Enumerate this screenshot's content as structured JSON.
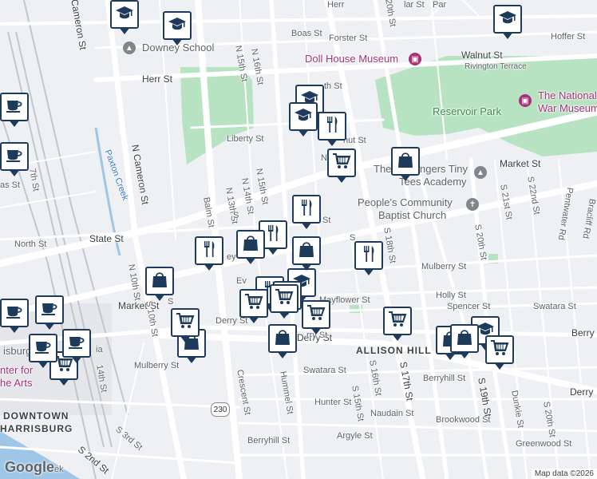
{
  "map": {
    "colors": {
      "background": "#eef0f3",
      "road": "#ffffff",
      "park": "#b8e3c2",
      "water": "#9fc6e6",
      "rail": "#c3c6cc",
      "pin_border": "#1f3b5b"
    },
    "streets": [
      {
        "id": "hoffer-st",
        "text": "Hoffer St"
      },
      {
        "id": "boas-st",
        "text": "Boas St"
      },
      {
        "id": "forster-st",
        "text": "Forster St"
      },
      {
        "id": "walnut-st",
        "text": "Walnut St"
      },
      {
        "id": "rivington-terrace",
        "text": "Rivington Terrace"
      },
      {
        "id": "herr-st",
        "text": "Herr St"
      },
      {
        "id": "liberty-st",
        "text": "Liberty St"
      },
      {
        "id": "market-st-east",
        "text": "Market St"
      },
      {
        "id": "market-st-west",
        "text": "Market St"
      },
      {
        "id": "state-st",
        "text": "State St"
      },
      {
        "id": "north-st",
        "text": "North St"
      },
      {
        "id": "mulberry-st-east",
        "text": "Mulberry St"
      },
      {
        "id": "mulberry-st-west",
        "text": "Mulberry St"
      },
      {
        "id": "holly-st",
        "text": "Holly St"
      },
      {
        "id": "spencer-st",
        "text": "Spencer St"
      },
      {
        "id": "swatara-st-east",
        "text": "Swatara St"
      },
      {
        "id": "swatara-st-south",
        "text": "Swatara St"
      },
      {
        "id": "mayflower-st",
        "text": "Mayflower St"
      },
      {
        "id": "derry-st-west",
        "text": "Derry St"
      },
      {
        "id": "derry-st-mid",
        "text": "Derry St"
      },
      {
        "id": "berry-east",
        "text": "Berry"
      },
      {
        "id": "derry-east",
        "text": "Derry"
      },
      {
        "id": "berryhill-st",
        "text": "Berryhill St"
      },
      {
        "id": "berryhill-st-south",
        "text": "Berryhill St"
      },
      {
        "id": "hunter-st",
        "text": "Hunter St"
      },
      {
        "id": "naudain-st",
        "text": "Naudain St"
      },
      {
        "id": "argyle-st",
        "text": "Argyle St"
      },
      {
        "id": "brookwood-st",
        "text": "Brookwood St"
      },
      {
        "id": "greenwood-st",
        "text": "Greenwood St"
      },
      {
        "id": "n-cameron-st-top",
        "text": "Cameron St"
      },
      {
        "id": "n-cameron-st",
        "text": "N Cameron St"
      },
      {
        "id": "n-16th-st",
        "text": "N 16th St"
      },
      {
        "id": "n-15th-st-top",
        "text": "N 15th St"
      },
      {
        "id": "n-15th-st",
        "text": "N 15th St"
      },
      {
        "id": "n-14th-st",
        "text": "N 14th St"
      },
      {
        "id": "n-13th-st",
        "text": "N 13th St"
      },
      {
        "id": "balm-st",
        "text": "Balm St"
      },
      {
        "id": "n-10th-st",
        "text": "N 10th St"
      },
      {
        "id": "s-10th-st",
        "text": "S 10th St"
      },
      {
        "id": "s-14th-st",
        "text": "14th St"
      },
      {
        "id": "crescent-st",
        "text": "Crescent St"
      },
      {
        "id": "hummel-st",
        "text": "Hummel St"
      },
      {
        "id": "s-16th-st",
        "text": "S 16th St"
      },
      {
        "id": "s-15th-st",
        "text": "S 15th St"
      },
      {
        "id": "s-17th-st",
        "text": "S 17th St"
      },
      {
        "id": "s-18th-st",
        "text": "S 18th St"
      },
      {
        "id": "s-19th-st",
        "text": "S 19th St"
      },
      {
        "id": "s-20th-st",
        "text": "S 20th St"
      },
      {
        "id": "s-20th-st-south",
        "text": "S 20th St"
      },
      {
        "id": "s-21st-st",
        "text": "S 21st St"
      },
      {
        "id": "s-22nd-st",
        "text": "S 22nd St"
      },
      {
        "id": "dunkle-st",
        "text": "Dunkle St"
      },
      {
        "id": "pentwater-rd",
        "text": "Pentwater Rd"
      },
      {
        "id": "bracliff-rd",
        "text": "Bracliff Rd"
      },
      {
        "id": "n-20th-st",
        "text": "20th St"
      },
      {
        "id": "s-3rd-st",
        "text": "S 3rd St"
      },
      {
        "id": "s-2nd-st",
        "text": "S 2nd St"
      },
      {
        "id": "n-7th-st",
        "text": "7th St"
      },
      {
        "id": "paxton-creek",
        "text": "Paxton Creek"
      },
      {
        "id": "frag-herr-top",
        "text": "Herr"
      },
      {
        "id": "frag-th-st",
        "text": "th St"
      },
      {
        "id": "frag-s-1",
        "text": "S"
      },
      {
        "id": "frag-ey",
        "text": "ey"
      },
      {
        "id": "frag-ev",
        "text": "Ev"
      },
      {
        "id": "frag-nut-st",
        "text": "nut St"
      },
      {
        "id": "frag-n",
        "text": "N"
      },
      {
        "id": "frag-s-2",
        "text": "S"
      },
      {
        "id": "frag-ry-st",
        "text": "rry St"
      },
      {
        "id": "frag-lar-st",
        "text": "lar St"
      },
      {
        "id": "frag-par",
        "text": "Par"
      },
      {
        "id": "frag-as-st",
        "text": "as St"
      },
      {
        "id": "frag-st",
        "text": "St"
      },
      {
        "id": "frag-s-3",
        "text": "S"
      },
      {
        "id": "frag-ia",
        "text": "ia"
      },
      {
        "id": "frag-ek",
        "text": "ek"
      }
    ],
    "districts": [
      {
        "id": "allison-hill",
        "text": "ALLISON HILL"
      },
      {
        "id": "downtown",
        "text": "DOWNTOWN"
      },
      {
        "id": "harrisburg",
        "text": "HARRISBURG"
      }
    ],
    "places": [
      {
        "id": "downey-school",
        "text": "Downey School",
        "color": "gray",
        "icon": "school-icon"
      },
      {
        "id": "doll-house-museum",
        "text": "Doll House Museum",
        "color": "purple",
        "icon": "museum-icon"
      },
      {
        "id": "reservoir-park",
        "text": "Reservoir Park",
        "color": "green",
        "icon": "park-icon"
      },
      {
        "id": "national-war-museum-1",
        "text": "The National",
        "color": "purple",
        "icon": "museum-icon"
      },
      {
        "id": "national-war-museum-2",
        "text": "War Museum",
        "color": "purple",
        "icon": ""
      },
      {
        "id": "tiny-tees-1",
        "text": "The",
        "color": "gray",
        "icon": ""
      },
      {
        "id": "tiny-tees-2",
        "text": "ngers Tiny",
        "color": "gray",
        "icon": ""
      },
      {
        "id": "tiny-tees-3",
        "text": "Tees Academy",
        "color": "gray",
        "icon": "school-icon"
      },
      {
        "id": "peoples-church-1",
        "text": "People's Community",
        "color": "gray",
        "icon": "church-icon"
      },
      {
        "id": "peoples-church-2",
        "text": "Baptist Church",
        "color": "gray",
        "icon": ""
      },
      {
        "id": "center-arts-1",
        "text": "nter for",
        "color": "purple",
        "icon": ""
      },
      {
        "id": "center-arts-2",
        "text": "he Arts",
        "color": "purple",
        "icon": ""
      },
      {
        "id": "harrisburg-frag",
        "text": "isburg",
        "color": "gray",
        "icon": ""
      }
    ],
    "route_shields": [
      {
        "id": "us-230",
        "text": "230"
      }
    ],
    "markers": [
      {
        "type": "school",
        "name": "school-marker"
      },
      {
        "type": "school",
        "name": "school-marker"
      },
      {
        "type": "school",
        "name": "school-marker"
      },
      {
        "type": "school",
        "name": "school-marker"
      },
      {
        "type": "school",
        "name": "school-marker"
      },
      {
        "type": "school",
        "name": "school-marker"
      },
      {
        "type": "school",
        "name": "school-marker"
      },
      {
        "type": "restaurant",
        "name": "restaurant-marker"
      },
      {
        "type": "restaurant",
        "name": "restaurant-marker"
      },
      {
        "type": "restaurant",
        "name": "restaurant-marker"
      },
      {
        "type": "restaurant",
        "name": "restaurant-marker"
      },
      {
        "type": "restaurant",
        "name": "restaurant-marker"
      },
      {
        "type": "restaurant",
        "name": "restaurant-marker"
      },
      {
        "type": "restaurant",
        "name": "restaurant-marker"
      },
      {
        "type": "shopping",
        "name": "shopping-bag-marker"
      },
      {
        "type": "shopping",
        "name": "shopping-bag-marker"
      },
      {
        "type": "shopping",
        "name": "shopping-bag-marker"
      },
      {
        "type": "shopping",
        "name": "shopping-bag-marker"
      },
      {
        "type": "shopping",
        "name": "shopping-bag-marker"
      },
      {
        "type": "shopping",
        "name": "shopping-bag-marker"
      },
      {
        "type": "shopping",
        "name": "shopping-bag-marker"
      },
      {
        "type": "shopping",
        "name": "shopping-bag-marker"
      },
      {
        "type": "cart",
        "name": "grocery-cart-marker"
      },
      {
        "type": "cart",
        "name": "grocery-cart-marker"
      },
      {
        "type": "cart",
        "name": "grocery-cart-marker"
      },
      {
        "type": "cart",
        "name": "grocery-cart-marker"
      },
      {
        "type": "cart",
        "name": "grocery-cart-marker"
      },
      {
        "type": "cart",
        "name": "grocery-cart-marker"
      },
      {
        "type": "cart",
        "name": "grocery-cart-marker"
      },
      {
        "type": "cart",
        "name": "grocery-cart-marker"
      },
      {
        "type": "cafe",
        "name": "cafe-marker"
      },
      {
        "type": "cafe",
        "name": "cafe-marker"
      },
      {
        "type": "cafe",
        "name": "cafe-marker"
      },
      {
        "type": "cafe",
        "name": "cafe-marker"
      },
      {
        "type": "cafe",
        "name": "cafe-marker"
      },
      {
        "type": "cafe",
        "name": "cafe-marker"
      }
    ],
    "google_logo": "Google",
    "attribution": "Map data ©2026"
  }
}
